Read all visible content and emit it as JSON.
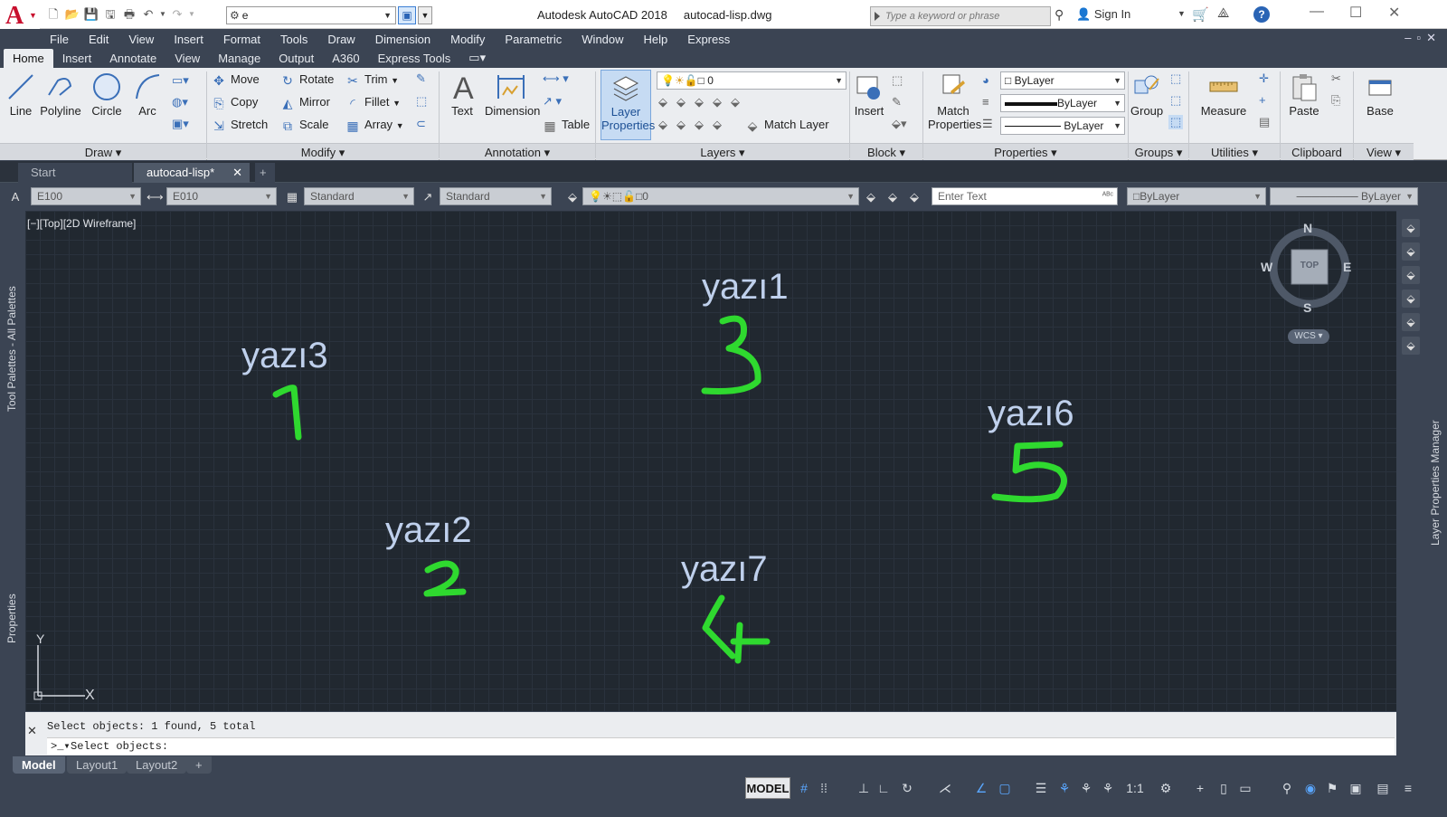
{
  "title": {
    "app": "Autodesk AutoCAD 2018",
    "file": "autocad-lisp.dwg"
  },
  "workspace": {
    "value": "e"
  },
  "search": {
    "placeholder": "Type a keyword or phrase"
  },
  "user": {
    "signin": "Sign In"
  },
  "menu": [
    "File",
    "Edit",
    "View",
    "Insert",
    "Format",
    "Tools",
    "Draw",
    "Dimension",
    "Modify",
    "Parametric",
    "Window",
    "Help",
    "Express"
  ],
  "ribbon_tabs": [
    "Home",
    "Insert",
    "Annotate",
    "View",
    "Manage",
    "Output",
    "A360",
    "Express Tools"
  ],
  "ribbon": {
    "draw": {
      "title": "Draw",
      "line": "Line",
      "polyline": "Polyline",
      "circle": "Circle",
      "arc": "Arc"
    },
    "modify": {
      "title": "Modify",
      "move": "Move",
      "rotate": "Rotate",
      "trim": "Trim",
      "copy": "Copy",
      "mirror": "Mirror",
      "fillet": "Fillet",
      "stretch": "Stretch",
      "scale": "Scale",
      "array": "Array"
    },
    "annotation": {
      "title": "Annotation",
      "text": "Text",
      "dimension": "Dimension",
      "table": "Table"
    },
    "layers": {
      "title": "Layers",
      "layer_properties_1": "Layer",
      "layer_properties_2": "Properties",
      "current_layer": "0",
      "match_layer": "Match Layer"
    },
    "block": {
      "title": "Block",
      "insert": "Insert"
    },
    "properties": {
      "title": "Properties",
      "match_1": "Match",
      "match_2": "Properties",
      "color": "ByLayer",
      "lineweight": "ByLayer",
      "linetype": "ByLayer"
    },
    "groups": {
      "title": "Groups",
      "group": "Group"
    },
    "utilities": {
      "title": "Utilities",
      "measure": "Measure"
    },
    "clipboard": {
      "title": "Clipboard",
      "paste": "Paste"
    },
    "view": {
      "title": "View",
      "base": "Base"
    }
  },
  "doc_tabs": {
    "start": "Start",
    "active": "autocad-lisp*"
  },
  "props_toolbar": {
    "textstyle": "E100",
    "dimstyle": "E010",
    "tablestyle": "Standard",
    "mleaderstyle": "Standard",
    "layer": "0",
    "enter_text": "Enter Text",
    "color": "ByLayer",
    "linetype": "ByLayer"
  },
  "viewport": {
    "label": "[−][Top][2D Wireframe]"
  },
  "drawing_texts": [
    {
      "text": "yazı1"
    },
    {
      "text": "yazı3"
    },
    {
      "text": "yazı6"
    },
    {
      "text": "yazı2"
    },
    {
      "text": "yazı7"
    }
  ],
  "annotations": [
    "1",
    "2",
    "3",
    "4",
    "5"
  ],
  "viewcube": {
    "n": "N",
    "s": "S",
    "e": "E",
    "w": "W",
    "face": "TOP",
    "wcs": "WCS"
  },
  "ucs": {
    "x": "X",
    "y": "Y"
  },
  "side_palettes": {
    "left_top": "Tool Palettes - All Palettes",
    "left_bottom": "Properties",
    "right": "Layer Properties Manager"
  },
  "command": {
    "history": "Select objects: 1 found, 5 total",
    "prompt": "Select objects:"
  },
  "layout_tabs": [
    "Model",
    "Layout1",
    "Layout2"
  ],
  "status": {
    "model": "MODEL",
    "scale": "1:1"
  },
  "colors": {
    "annotation_green": "#2fd92f",
    "canvas_bg": "#212830",
    "text_color": "#bfd0ec"
  }
}
